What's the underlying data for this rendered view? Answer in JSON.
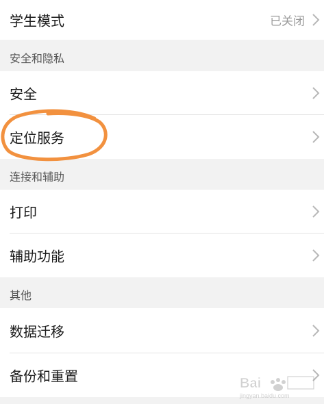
{
  "colors": {
    "background": "#f2f2f2",
    "row_background": "#ffffff",
    "annotation": "#f2913f",
    "chevron": "#b8b8b8"
  },
  "rows": {
    "student_mode": {
      "label": "学生模式",
      "value": "已关闭"
    },
    "security": {
      "label": "安全"
    },
    "location": {
      "label": "定位服务"
    },
    "print": {
      "label": "打印"
    },
    "accessibility": {
      "label": "辅助功能"
    },
    "data_migration": {
      "label": "数据迁移"
    },
    "backup_reset": {
      "label": "备份和重置"
    }
  },
  "sections": {
    "security_privacy": "安全和隐私",
    "connection_assist": "连接和辅助",
    "other": "其他"
  },
  "watermark": {
    "brand": "Bai",
    "sub": "jingyan.baidu.com"
  }
}
